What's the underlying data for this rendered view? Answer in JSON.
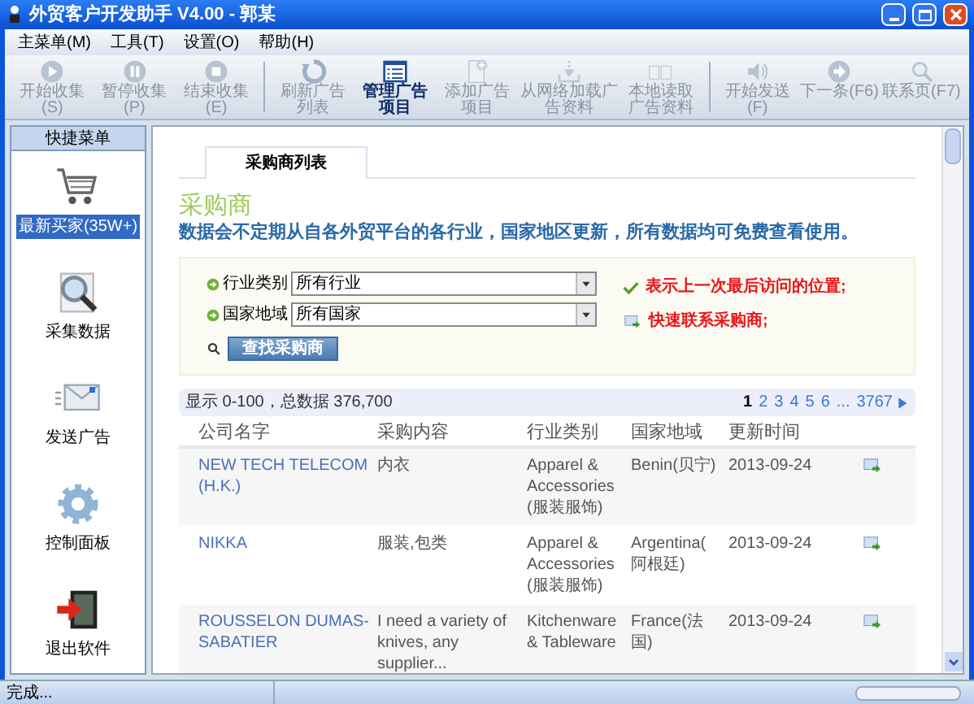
{
  "window": {
    "title": "外贸客户开发助手 V4.00 - 郭某"
  },
  "menu": [
    "主菜单(M)",
    "工具(T)",
    "设置(O)",
    "帮助(H)"
  ],
  "toolbar_groups": [
    [
      {
        "label": "开始收集(S)",
        "kind": "play",
        "disabled": true
      },
      {
        "label": "暂停收集(P)",
        "kind": "pause",
        "disabled": true
      },
      {
        "label": "结束收集(E)",
        "kind": "stop",
        "disabled": true
      }
    ],
    [
      {
        "label": "刷新广告列表",
        "kind": "refresh",
        "disabled": true
      },
      {
        "label": "管理广告项目",
        "kind": "list",
        "disabled": false
      },
      {
        "label": "添加广告项目",
        "kind": "add",
        "disabled": true
      },
      {
        "label": "从网络加载广告资料",
        "kind": "download",
        "disabled": true
      },
      {
        "label": "本地读取广告资料",
        "kind": "book",
        "disabled": true
      }
    ],
    [
      {
        "label": "开始发送(F)",
        "kind": "speaker",
        "disabled": true
      },
      {
        "label": "下一条(F6)",
        "kind": "next",
        "disabled": true
      },
      {
        "label": "联系页(F7)",
        "kind": "search",
        "disabled": true
      }
    ]
  ],
  "sidebar": {
    "title": "快捷菜单",
    "items": [
      {
        "label": "最新买家(35W+)",
        "kind": "cart",
        "selected": true
      },
      {
        "label": "采集数据",
        "kind": "search",
        "selected": false
      },
      {
        "label": "发送广告",
        "kind": "mail",
        "selected": false
      },
      {
        "label": "控制面板",
        "kind": "gear",
        "selected": false
      },
      {
        "label": "退出软件",
        "kind": "exit",
        "selected": false
      }
    ]
  },
  "tabs": [
    {
      "label": "采购商列表",
      "selected": true
    }
  ],
  "heading": "采购商",
  "description": "数据会不定期从自各外贸平台的各行业，国家地区更新，所有数据均可免费查看使用。",
  "filters": [
    {
      "label": "行业类别",
      "value": "所有行业"
    },
    {
      "label": "国家地域",
      "value": "所有国家"
    }
  ],
  "search_button": "查找采购商",
  "legend": [
    {
      "kind": "check",
      "text": "表示上一次最后访问的位置;"
    },
    {
      "kind": "mail",
      "text": "快速联系采购商;"
    }
  ],
  "summary": "显示 0-100，总数据 376,700",
  "pages": [
    {
      "label": "1",
      "selected": true
    },
    {
      "label": "2",
      "selected": false
    },
    {
      "label": "3",
      "selected": false
    },
    {
      "label": "4",
      "selected": false
    },
    {
      "label": "5",
      "selected": false
    },
    {
      "label": "6",
      "selected": false
    },
    {
      "label": "...",
      "selected": false
    },
    {
      "label": "3767",
      "selected": false
    }
  ],
  "table": {
    "columns": [
      "公司名字",
      "采购内容",
      "行业类别",
      "国家地域",
      "更新时间"
    ],
    "rows": [
      {
        "company": "NEW TECH TELECOM (H.K.)",
        "content": "内衣",
        "industry": "Apparel & Accessories (服装服饰)",
        "country": "Benin(贝宁)",
        "date": "2013-09-24"
      },
      {
        "company": "NIKKA",
        "content": "服装,包类",
        "industry": "Apparel & Accessories (服装服饰)",
        "country": "Argentina(阿根廷)",
        "date": "2013-09-24"
      },
      {
        "company": "ROUSSELON DUMAS-SABATIER",
        "content": "I need a variety of knives, any supplier...",
        "industry": "Kitchenware & Tableware",
        "country": "France(法国)",
        "date": "2013-09-24"
      }
    ]
  },
  "status_bar": {
    "text": "完成..."
  }
}
